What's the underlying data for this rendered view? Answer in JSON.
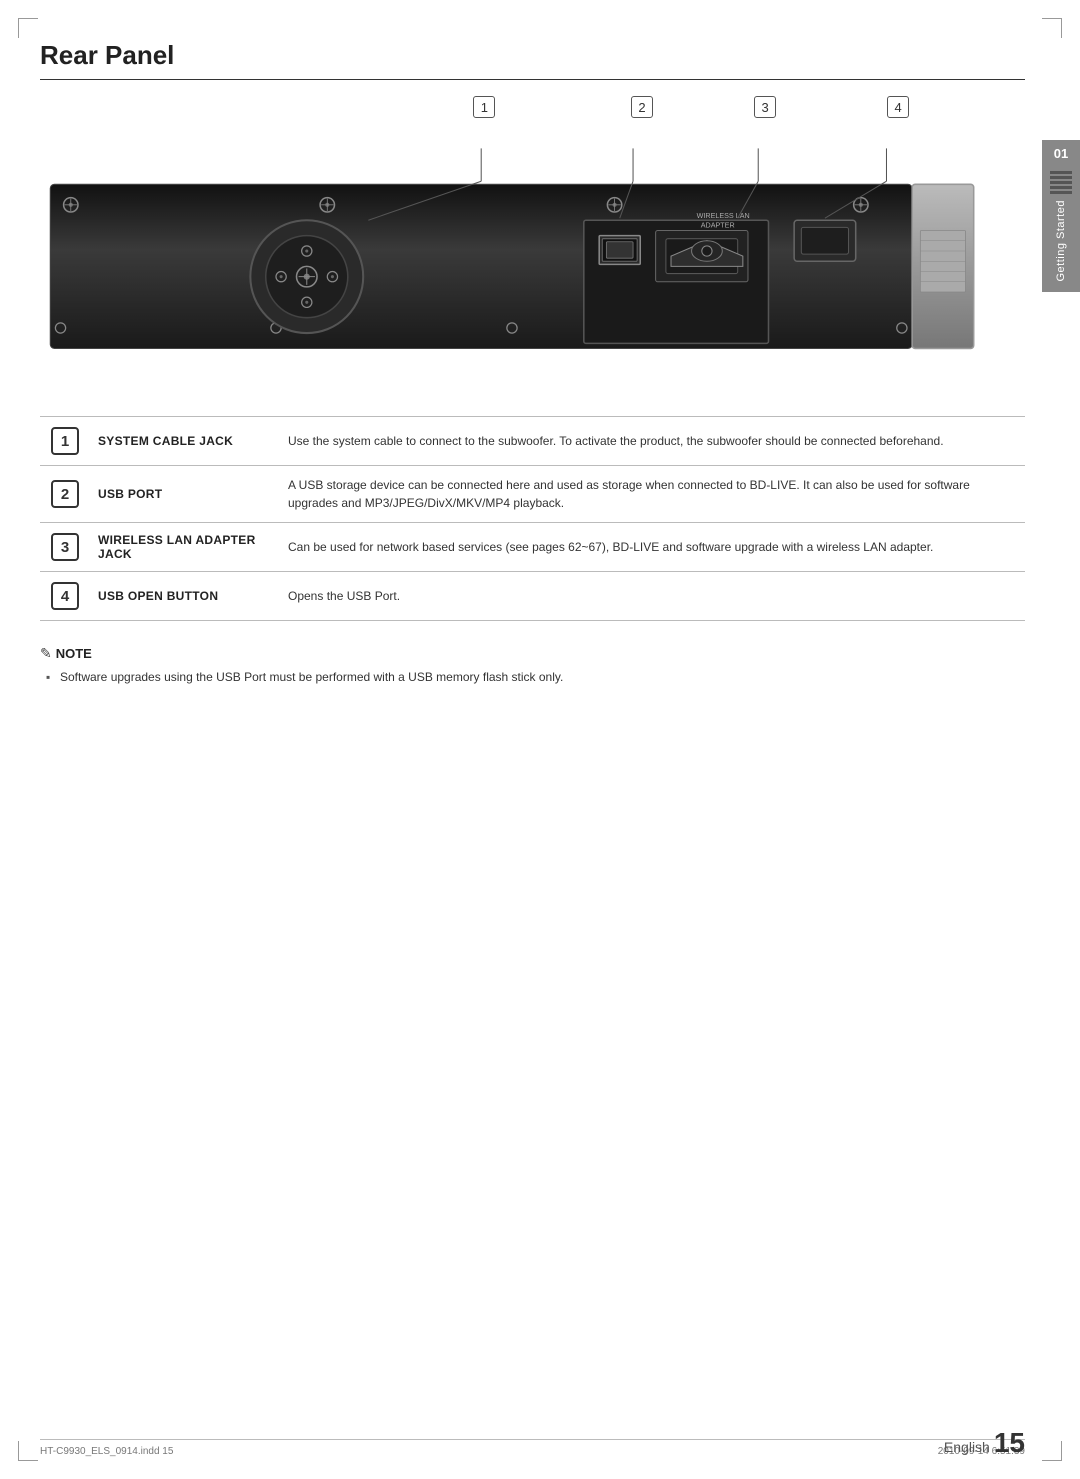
{
  "page": {
    "title": "Rear Panel",
    "language": "English",
    "page_number": "15",
    "footer_left": "HT-C9930_ELS_0914.indd  15",
    "footer_right": "2010-09-14   6:51:39"
  },
  "diagram": {
    "numbers": [
      {
        "label": "1",
        "left_pct": 46
      },
      {
        "label": "2",
        "left_pct": 62
      },
      {
        "label": "3",
        "left_pct": 74
      },
      {
        "label": "4",
        "left_pct": 88
      }
    ]
  },
  "features": [
    {
      "number": "1",
      "label": "SYSTEM CABLE JACK",
      "description": "Use the system cable to connect to the subwoofer. To activate the product, the subwoofer should be connected beforehand."
    },
    {
      "number": "2",
      "label": "USB PORT",
      "description": "A USB storage device can be connected here and used as storage when connected to BD-LIVE. It can also be used for software upgrades and MP3/JPEG/DivX/MKV/MP4 playback."
    },
    {
      "number": "3",
      "label": "WIRELESS LAN ADAPTER JACK",
      "description": "Can be used for network based services (see pages 62~67), BD-LIVE and software upgrade with a wireless LAN adapter."
    },
    {
      "number": "4",
      "label": "USB OPEN BUTTON",
      "description": "Opens the USB Port."
    }
  ],
  "note": {
    "title": "NOTE",
    "items": [
      "Software upgrades using the USB Port must be performed with a USB memory flash stick only."
    ]
  },
  "side_tab": {
    "number": "01",
    "text": "Getting Started"
  }
}
